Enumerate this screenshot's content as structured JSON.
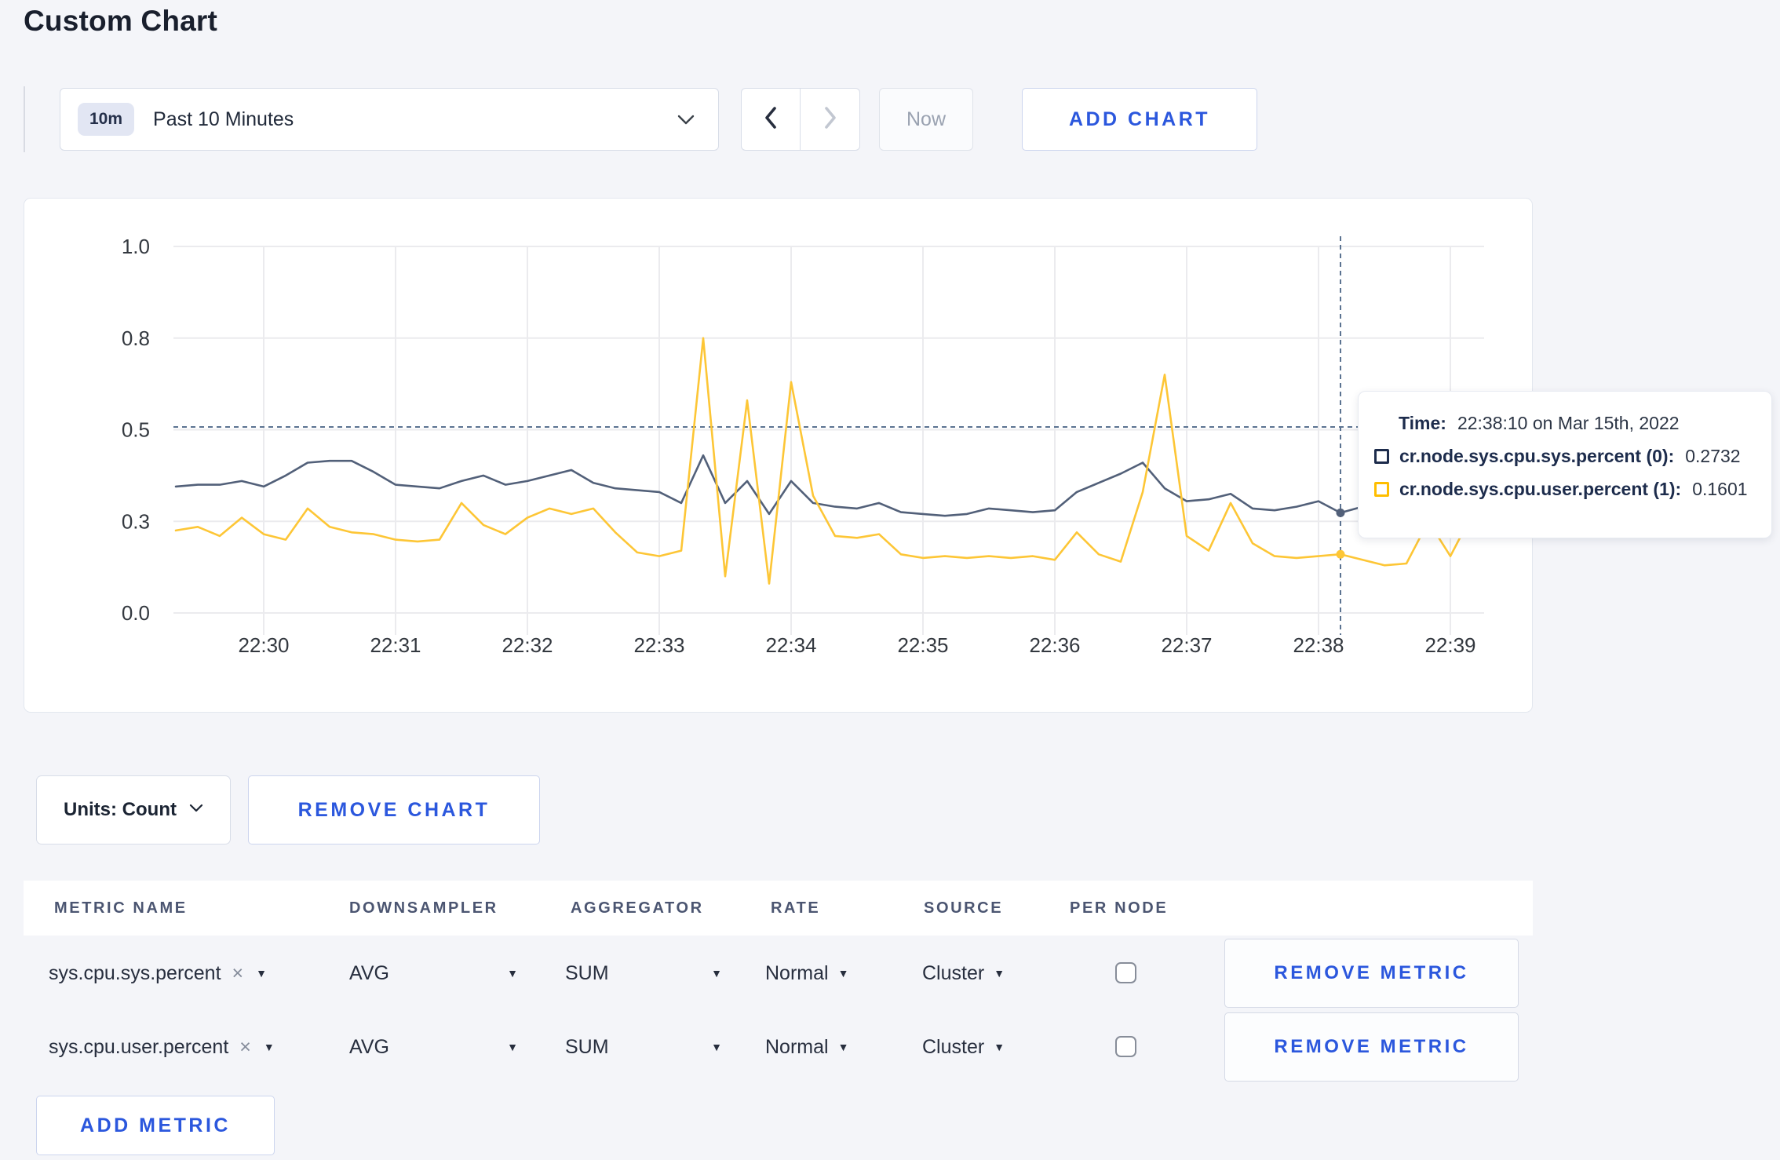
{
  "page": {
    "title": "Custom Chart"
  },
  "toolbar": {
    "time_range": {
      "badge": "10m",
      "label": "Past 10 Minutes"
    },
    "now_label": "Now",
    "add_chart_label": "ADD CHART"
  },
  "chart_data": {
    "type": "line",
    "title": "",
    "xlabel": "",
    "ylabel": "",
    "ylim": [
      0,
      1
    ],
    "grid": true,
    "x_start_time": "22:29:20",
    "point_interval_seconds": 10,
    "x_ticks": [
      "22:30",
      "22:31",
      "22:32",
      "22:33",
      "22:34",
      "22:35",
      "22:36",
      "22:37",
      "22:38",
      "22:39"
    ],
    "y_ticks": [
      {
        "value": 0.0,
        "label": "0.0"
      },
      {
        "value": 0.25,
        "label": "0.3"
      },
      {
        "value": 0.5,
        "label": "0.5"
      },
      {
        "value": 0.75,
        "label": "0.8"
      },
      {
        "value": 1.0,
        "label": "1.0"
      }
    ],
    "series": [
      {
        "name": "cr.node.sys.cpu.sys.percent (0)",
        "color": "#526079",
        "values": [
          0.345,
          0.35,
          0.35,
          0.36,
          0.345,
          0.375,
          0.41,
          0.415,
          0.415,
          0.385,
          0.35,
          0.345,
          0.34,
          0.36,
          0.375,
          0.35,
          0.36,
          0.375,
          0.39,
          0.355,
          0.34,
          0.335,
          0.33,
          0.3,
          0.43,
          0.3,
          0.36,
          0.27,
          0.36,
          0.3,
          0.29,
          0.285,
          0.3,
          0.275,
          0.27,
          0.265,
          0.27,
          0.285,
          0.28,
          0.275,
          0.28,
          0.33,
          0.355,
          0.38,
          0.41,
          0.34,
          0.305,
          0.31,
          0.325,
          0.285,
          0.28,
          0.29,
          0.305,
          0.2732,
          0.29,
          0.3,
          0.295,
          0.3,
          0.31,
          0.305
        ]
      },
      {
        "name": "cr.node.sys.cpu.user.percent (1)",
        "color": "#fdc636",
        "values": [
          0.225,
          0.235,
          0.21,
          0.26,
          0.215,
          0.2,
          0.285,
          0.235,
          0.22,
          0.215,
          0.2,
          0.195,
          0.2,
          0.3,
          0.24,
          0.215,
          0.26,
          0.285,
          0.27,
          0.285,
          0.22,
          0.165,
          0.155,
          0.17,
          0.75,
          0.1,
          0.58,
          0.08,
          0.63,
          0.32,
          0.21,
          0.205,
          0.215,
          0.16,
          0.15,
          0.155,
          0.15,
          0.155,
          0.15,
          0.155,
          0.145,
          0.22,
          0.16,
          0.14,
          0.33,
          0.65,
          0.21,
          0.17,
          0.3,
          0.19,
          0.155,
          0.15,
          0.155,
          0.1601,
          0.145,
          0.13,
          0.135,
          0.25,
          0.155,
          0.27
        ]
      }
    ],
    "legend_position": "tooltip",
    "crosshair": {
      "point_index": 53,
      "time": "22:38:10",
      "y_value": 0.5075,
      "color": "#5b7391"
    }
  },
  "tooltip": {
    "time_label": "Time:",
    "time_value": "22:38:10 on Mar 15th, 2022",
    "rows": [
      {
        "name": "cr.node.sys.cpu.sys.percent (0):",
        "value": "0.2732",
        "swatch_color": "#1d2c4c"
      },
      {
        "name": "cr.node.sys.cpu.user.percent (1):",
        "value": "0.1601",
        "swatch_color": "#ffbe00"
      }
    ]
  },
  "chart_footer": {
    "units_label": "Units: Count",
    "remove_chart_label": "REMOVE CHART"
  },
  "metrics_table": {
    "headers": [
      "METRIC NAME",
      "DOWNSAMPLER",
      "AGGREGATOR",
      "RATE",
      "SOURCE",
      "PER NODE"
    ],
    "rows": [
      {
        "name": "sys.cpu.sys.percent",
        "clear": "×",
        "downsampler": "AVG",
        "aggregator": "SUM",
        "rate": "Normal",
        "source": "Cluster",
        "per_node_checked": false,
        "remove_label": "REMOVE METRIC"
      },
      {
        "name": "sys.cpu.user.percent",
        "clear": "×",
        "downsampler": "AVG",
        "aggregator": "SUM",
        "rate": "Normal",
        "source": "Cluster",
        "per_node_checked": false,
        "remove_label": "REMOVE METRIC"
      }
    ],
    "add_metric_label": "ADD METRIC"
  },
  "colors": {
    "accent_blue": "#2b57dd",
    "series_sys": "#526079",
    "series_user": "#fdc636",
    "page_bg": "#f4f5f9"
  }
}
